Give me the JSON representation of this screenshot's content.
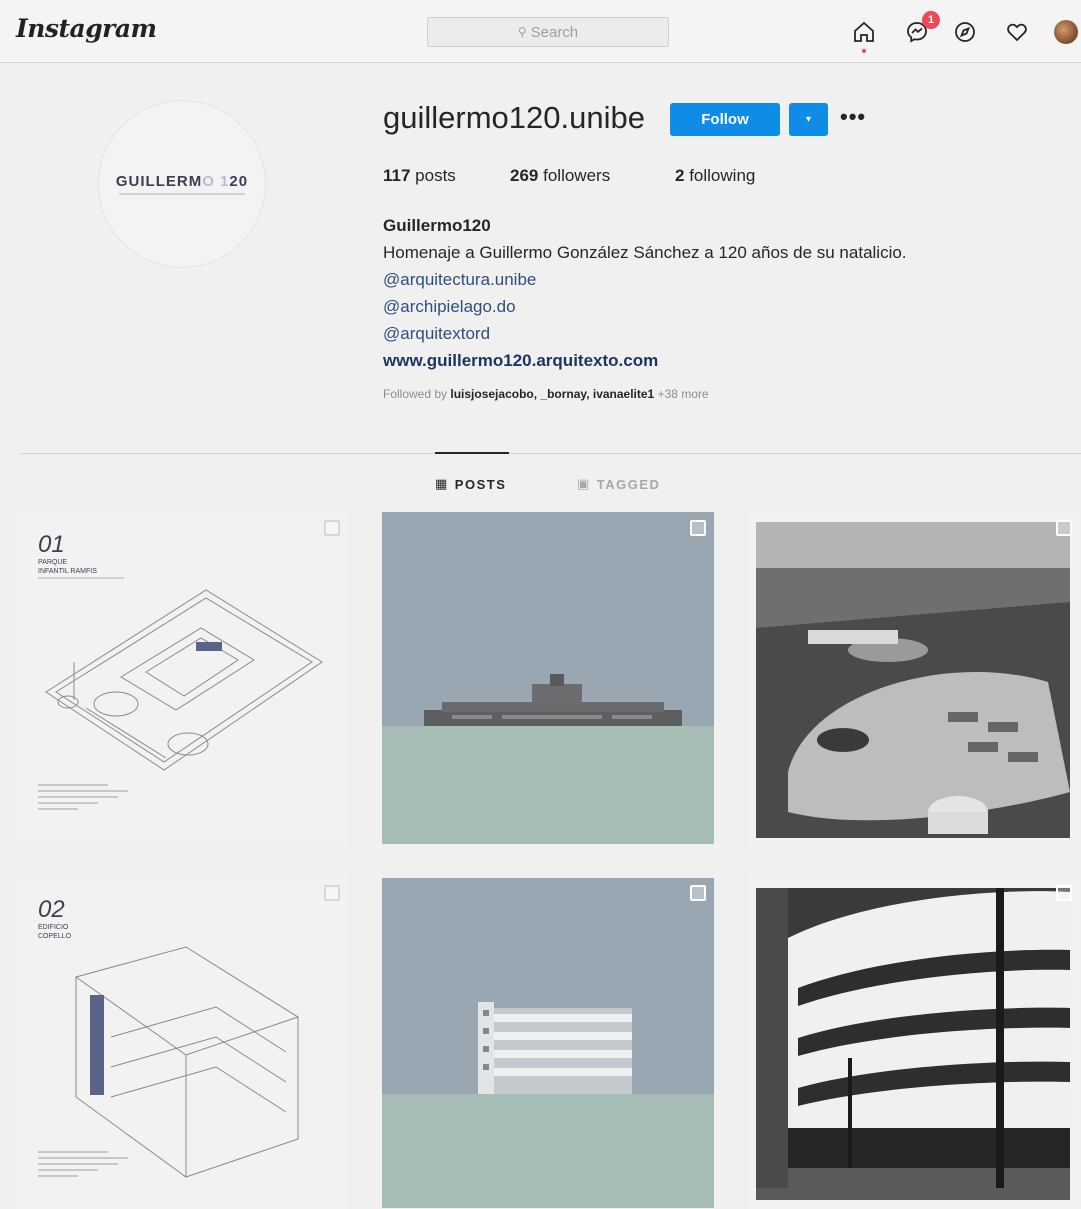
{
  "nav": {
    "logo": "Instagram",
    "search_placeholder": "Search",
    "messages_badge": "1",
    "icons": [
      "home-icon",
      "messenger-icon",
      "explore-icon",
      "activity-heart-icon",
      "profile-avatar"
    ]
  },
  "profile": {
    "avatar_text_dark": "GUILLERM",
    "avatar_text_light": "O 1",
    "avatar_text_tail": "20",
    "username": "guillermo120.unibe",
    "follow_label": "Follow",
    "dropdown_label": "▾",
    "more_label": "•••",
    "stats": {
      "posts_count": "117",
      "posts_label": "posts",
      "followers_count": "269",
      "followers_label": "followers",
      "following_count": "2",
      "following_label": "following"
    },
    "bio": {
      "name": "Guillermo120",
      "text": "Homenaje a Guillermo González Sánchez a 120 años de su natalicio.",
      "links": [
        "@arquitectura.unibe",
        "@archipielago.do",
        "@arquitextord"
      ],
      "website": "www.guillermo120.arquitexto.com"
    },
    "followed_by": {
      "prefix": "Followed by",
      "users": "luisjosejacobo, _bornay, ivanaelite1",
      "more": "+38 more"
    }
  },
  "tabs": [
    {
      "label": "POSTS",
      "icon": "grid-icon",
      "active": true
    },
    {
      "label": "TAGGED",
      "icon": "tagged-icon",
      "active": false
    }
  ],
  "posts": [
    {
      "number": "01",
      "title_line1": "PARQUE",
      "title_line2": "INFANTIL RAMFIS",
      "kind": "isometric drawing"
    },
    {
      "kind": "elevation illustration"
    },
    {
      "kind": "aerial photograph"
    },
    {
      "number": "02",
      "title_line1": "EDIFICIO",
      "title_line2": "COPELLO",
      "kind": "isometric drawing"
    },
    {
      "kind": "elevation illustration"
    },
    {
      "kind": "street photograph"
    }
  ],
  "colors": {
    "follow_blue": "#0f8be8",
    "badge_red": "#ed4956",
    "link_blue": "#2f4f7d",
    "tile_sky": "#98a7b2",
    "tile_ground": "#a6bdb5"
  }
}
